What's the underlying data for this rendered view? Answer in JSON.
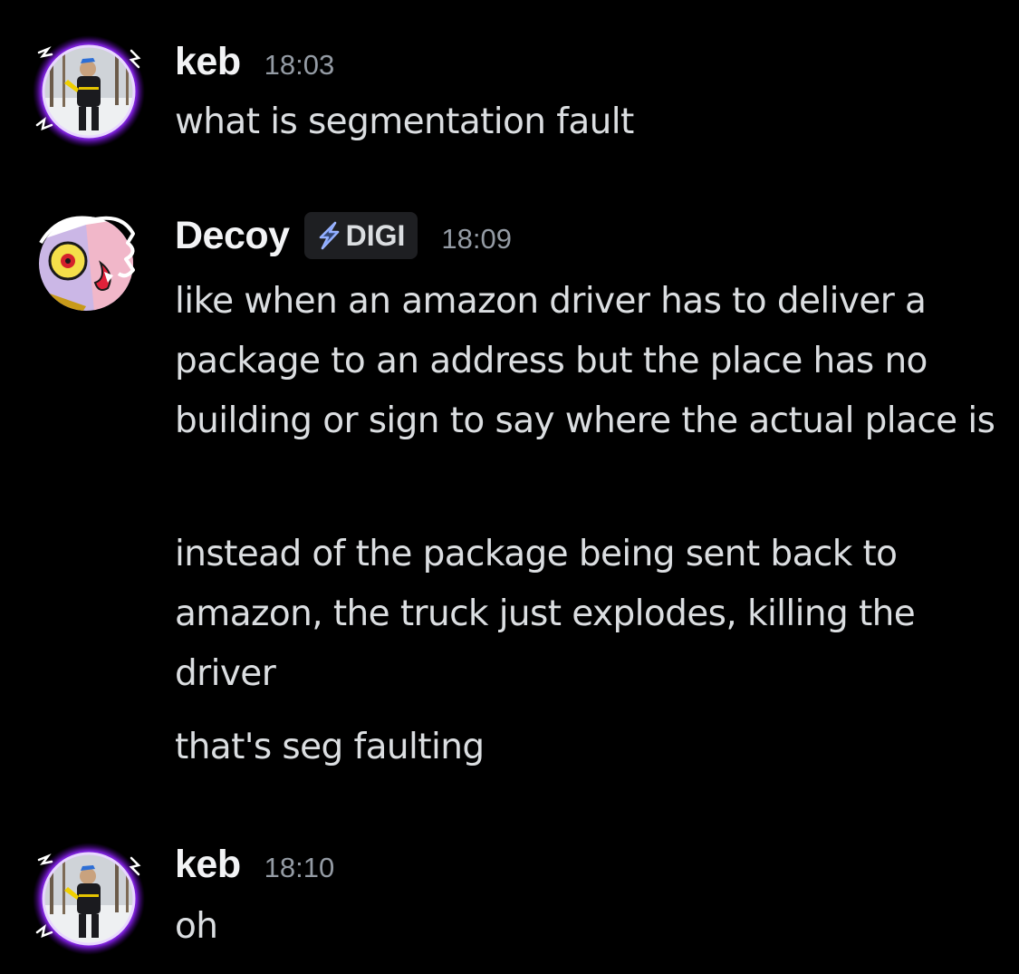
{
  "messages": [
    {
      "username": "keb",
      "timestamp": "18:03",
      "lines": [
        "what is segmentation fault"
      ]
    },
    {
      "username": "Decoy",
      "tag": {
        "label": "DIGI",
        "icon": "lightning-icon"
      },
      "timestamp": "18:09",
      "lines": [
        "like when an amazon driver has to deliver a package to an address but the place has no building or sign to say where the actual place is",
        "instead of the package being sent back to amazon, the truck just explodes, killing the driver",
        "that's seg faulting"
      ]
    },
    {
      "username": "keb",
      "timestamp": "18:10",
      "lines": [
        "oh"
      ]
    }
  ],
  "colors": {
    "background": "#000000",
    "username": "#f2f3f5",
    "text": "#dbdee1",
    "timestamp": "#949ba4",
    "tag_background": "#1e1f22",
    "avatar_glow": "#9b30ff"
  }
}
